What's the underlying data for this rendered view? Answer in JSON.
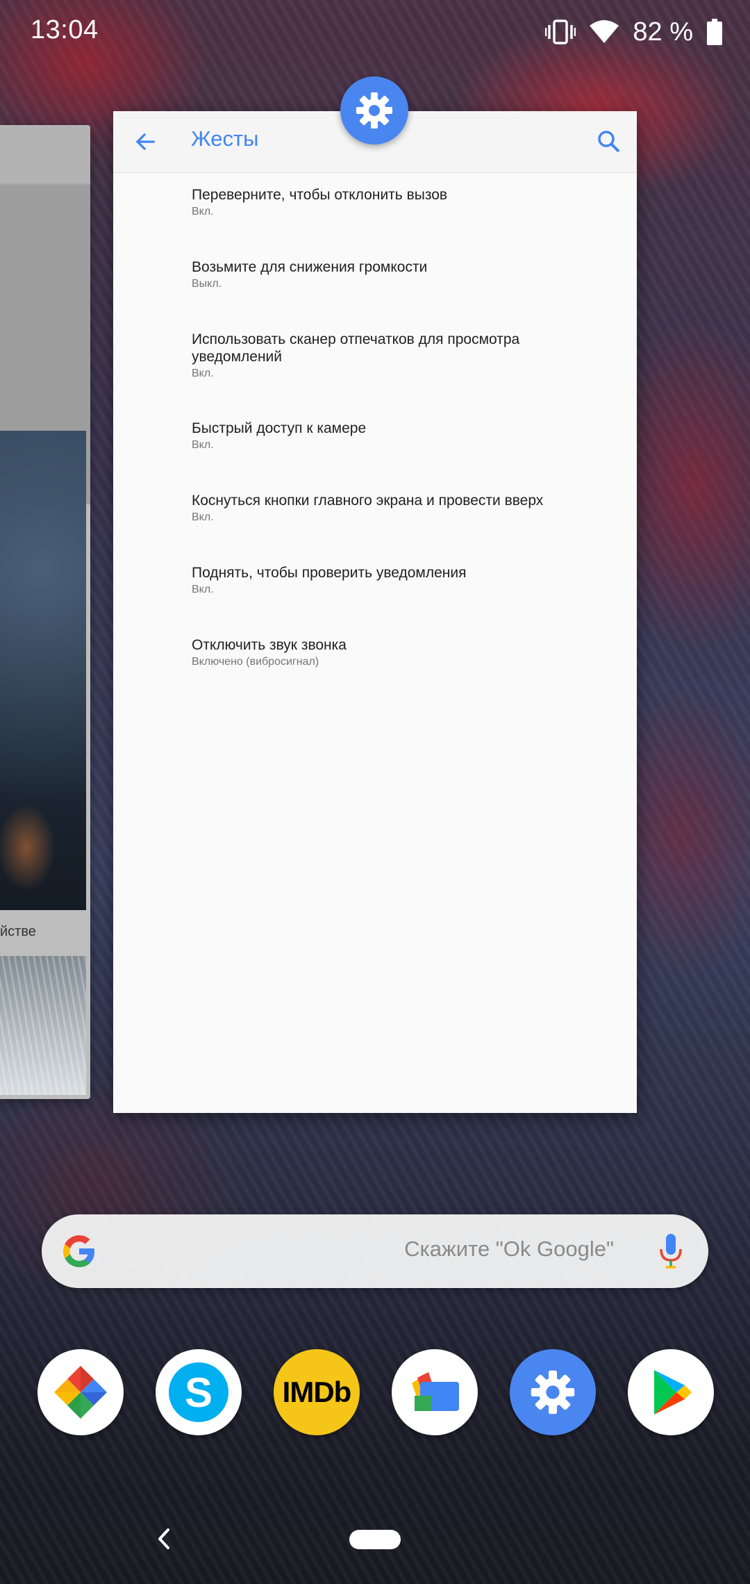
{
  "status_bar": {
    "time": "13:04",
    "battery_percent": "82 %",
    "icons": [
      "vibrate-icon",
      "wifi-icon",
      "battery-icon"
    ]
  },
  "left_card": {
    "caption": "йстве"
  },
  "settings_card": {
    "title": "Жесты",
    "icons": [
      "back-arrow-icon",
      "search-icon",
      "settings-gear-icon"
    ],
    "items": [
      {
        "title": "Переверните, чтобы отклонить вызов",
        "subtitle": "Вкл."
      },
      {
        "title": "Возьмите для снижения громкости",
        "subtitle": "Выкл."
      },
      {
        "title": "Использовать сканер отпечатков для просмотра уведомлений",
        "subtitle": "Вкл."
      },
      {
        "title": "Быстрый доступ к камере",
        "subtitle": "Вкл."
      },
      {
        "title": "Коснуться кнопки главного экрана и провести вверх",
        "subtitle": "Вкл."
      },
      {
        "title": "Поднять, чтобы проверить уведомления",
        "subtitle": "Вкл."
      },
      {
        "title": "Отключить звук звонка",
        "subtitle": "Включено (вибросигнал)"
      }
    ]
  },
  "search_bar": {
    "hint": "Скажите \"Ok Google\"",
    "icons": [
      "google-g-icon",
      "mic-icon"
    ]
  },
  "dock": {
    "apps": [
      {
        "name": "photos-app-icon"
      },
      {
        "name": "skype-app-icon",
        "label": "S"
      },
      {
        "name": "imdb-app-icon",
        "label": "IMDb"
      },
      {
        "name": "files-app-icon"
      },
      {
        "name": "settings-app-icon"
      },
      {
        "name": "play-store-app-icon"
      }
    ]
  },
  "nav_bar": {
    "icons": [
      "nav-back-icon",
      "nav-home-pill"
    ]
  },
  "colors": {
    "accent": "#4285f4",
    "imdb_yellow": "#f5c518",
    "skype_blue": "#00aff0"
  }
}
